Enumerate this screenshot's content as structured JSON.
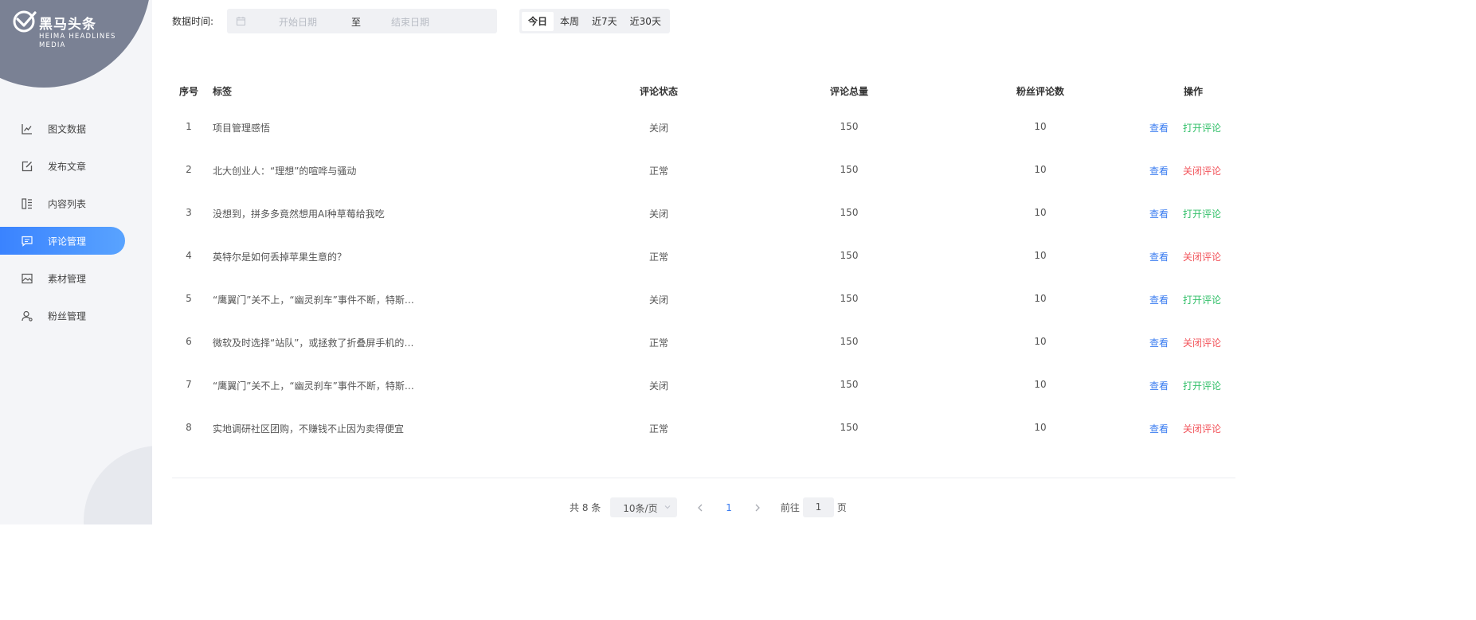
{
  "brand": {
    "title": "黑马头条",
    "subtitle": "HEIMA HEADLINES MEDIA"
  },
  "sidebar": {
    "items": [
      {
        "label": "图文数据",
        "icon": "line-chart-icon",
        "active": false
      },
      {
        "label": "发布文章",
        "icon": "edit-icon",
        "active": false
      },
      {
        "label": "内容列表",
        "icon": "list-icon",
        "active": false
      },
      {
        "label": "评论管理",
        "icon": "comment-icon",
        "active": true
      },
      {
        "label": "素材管理",
        "icon": "image-icon",
        "active": false
      },
      {
        "label": "粉丝管理",
        "icon": "user-icon",
        "active": false
      }
    ]
  },
  "filter": {
    "label": "数据时间:",
    "start_placeholder": "开始日期",
    "separator": "至",
    "end_placeholder": "结束日期",
    "quick": [
      "今日",
      "本周",
      "近7天",
      "近30天"
    ],
    "active_quick": "今日"
  },
  "table": {
    "headers": {
      "no": "序号",
      "tag": "标签",
      "status": "评论状态",
      "total": "评论总量",
      "fans": "粉丝评论数",
      "ops": "操作"
    },
    "rows": [
      {
        "no": "1",
        "tag": "项目管理感悟",
        "status": "关闭",
        "total": "150",
        "fans": "10",
        "view": "查看",
        "action": "打开评论",
        "action_type": "open"
      },
      {
        "no": "2",
        "tag": "北大创业人：“理想”的喧哗与骚动",
        "status": "正常",
        "total": "150",
        "fans": "10",
        "view": "查看",
        "action": "关闭评论",
        "action_type": "close"
      },
      {
        "no": "3",
        "tag": "没想到，拼多多竟然想用AI种草莓给我吃",
        "status": "关闭",
        "total": "150",
        "fans": "10",
        "view": "查看",
        "action": "打开评论",
        "action_type": "open"
      },
      {
        "no": "4",
        "tag": "英特尔是如何丢掉苹果生意的？",
        "status": "正常",
        "total": "150",
        "fans": "10",
        "view": "查看",
        "action": "关闭评论",
        "action_type": "close"
      },
      {
        "no": "5",
        "tag": "“鹰翼门”关不上，“幽灵刹车”事件不断，特斯拉…",
        "status": "关闭",
        "total": "150",
        "fans": "10",
        "view": "查看",
        "action": "打开评论",
        "action_type": "open"
      },
      {
        "no": "6",
        "tag": "微软及时选择“站队”，或拯救了折叠屏手机的未…",
        "status": "正常",
        "total": "150",
        "fans": "10",
        "view": "查看",
        "action": "关闭评论",
        "action_type": "close"
      },
      {
        "no": "7",
        "tag": "“鹰翼门”关不上，“幽灵刹车”事件不断，特斯拉…",
        "status": "关闭",
        "total": "150",
        "fans": "10",
        "view": "查看",
        "action": "打开评论",
        "action_type": "open"
      },
      {
        "no": "8",
        "tag": "实地调研社区团购，不赚钱不止因为卖得便宜",
        "status": "正常",
        "total": "150",
        "fans": "10",
        "view": "查看",
        "action": "关闭评论",
        "action_type": "close"
      }
    ]
  },
  "pagination": {
    "total": "共 8 条",
    "page_size": "10条/页",
    "current": "1",
    "goto_label": "前往",
    "goto_value": "1",
    "goto_suffix": "页"
  },
  "colors": {
    "accent": "#3a83ff",
    "open": "#33c06a",
    "close": "#f2545b",
    "sidebar_bg": "#f4f5f8"
  }
}
